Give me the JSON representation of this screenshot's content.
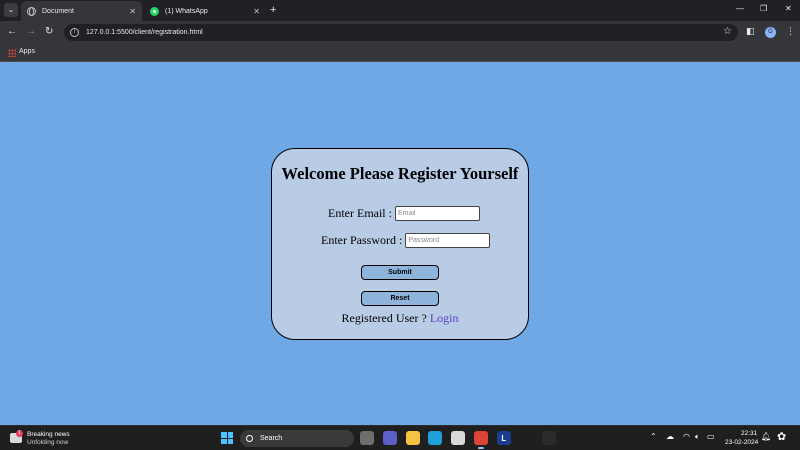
{
  "browser": {
    "tabs": [
      {
        "title": "Document",
        "active": true
      },
      {
        "title": "(1) WhatsApp",
        "active": false
      }
    ],
    "new_tab_symbol": "+",
    "url": "127.0.0.1:5500/client/registration.html",
    "profile_initial": "G",
    "bookmarks": {
      "apps_label": "Apps"
    }
  },
  "form": {
    "title": "Welcome Please Register Yourself",
    "email_label": "Enter Email :",
    "email_placeholder": "Email",
    "password_label": "Enter Password :",
    "password_placeholder": "Password",
    "submit_label": "Submit",
    "reset_label": "Reset",
    "registered_text": "Registered User ?",
    "login_link": "Login"
  },
  "taskbar": {
    "news_badge": "1",
    "news_title": "Breaking news",
    "news_subtitle": "Unfolding now",
    "search_text": "Search",
    "apps": [
      {
        "name": "task-view-icon",
        "label": "",
        "color": "#6e6e6e"
      },
      {
        "name": "teams-icon",
        "label": "",
        "color": "#5b5fc7"
      },
      {
        "name": "file-explorer-icon",
        "label": "",
        "color": "#f5c242"
      },
      {
        "name": "edge-icon",
        "label": "",
        "color": "#1f9fd9"
      },
      {
        "name": "store-icon",
        "label": "",
        "color": "#d9d9d9"
      },
      {
        "name": "chrome-icon",
        "label": "",
        "color": "#db4437"
      },
      {
        "name": "l-app-icon",
        "label": "L",
        "color": "#1a3d8f"
      },
      {
        "name": "cortana-icon",
        "label": "",
        "color": "#1f1f1f"
      },
      {
        "name": "terminal-icon",
        "label": "",
        "color": "#2b2b2b"
      },
      {
        "name": "vscode-icon",
        "label": "",
        "color": "#1f1f1f"
      }
    ],
    "clock_time": "22:31",
    "clock_date": "23-02-2024"
  },
  "colors": {
    "page_background": "#6fa8e4",
    "card_background": "#b8cce6",
    "button_background": "#8fb4dc",
    "login_link": "#5a3fc0"
  }
}
